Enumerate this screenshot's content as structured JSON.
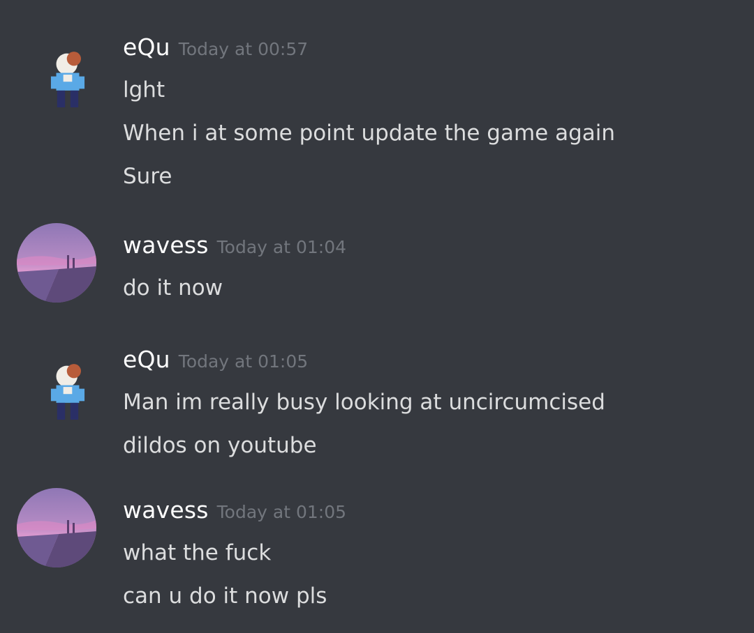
{
  "messages": [
    {
      "author": "eQu",
      "timestamp": "Today at 00:57",
      "avatar": "pixel-character-avatar",
      "lines": [
        "lght",
        "When i at some point update the game again",
        "Sure"
      ]
    },
    {
      "author": "wavess",
      "timestamp": "Today at 01:04",
      "avatar": "bridge-sunset-avatar",
      "lines": [
        "do it now"
      ]
    },
    {
      "author": "eQu",
      "timestamp": "Today at 01:05",
      "avatar": "pixel-character-avatar",
      "lines": [
        "Man im really busy looking at uncircumcised",
        "dildos on youtube"
      ]
    },
    {
      "author": "wavess",
      "timestamp": "Today at 01:05",
      "avatar": "bridge-sunset-avatar",
      "lines": [
        "what the fuck",
        "can u do it now pls"
      ]
    }
  ],
  "colors": {
    "background": "#36393f",
    "username": "#ffffff",
    "timestamp": "#72767d",
    "message_text": "#dcddde"
  }
}
